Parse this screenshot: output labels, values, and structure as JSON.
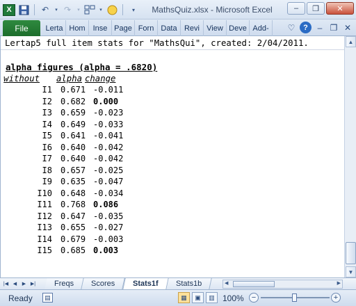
{
  "window": {
    "title": "MathsQuiz.xlsx  -  Microsoft Excel",
    "app_icon": "X",
    "qat_icons": [
      "excel-icon",
      "save-icon",
      "undo-icon",
      "redo-icon",
      "form-icon",
      "smiley-icon",
      "customize-icon"
    ],
    "controls": {
      "minimize": "–",
      "restore": "❐",
      "close": "✕"
    }
  },
  "ribbon": {
    "file_label": "File",
    "tabs": [
      "Lerta",
      "Hom",
      "Inse",
      "Page",
      "Forn",
      "Data",
      "Revi",
      "View",
      "Deve",
      "Add-"
    ],
    "icons": [
      "minimize-ribbon-icon",
      "help-icon",
      "window-minimize-icon",
      "window-restore-icon",
      "window-close-icon"
    ]
  },
  "sheet": {
    "title_line": "Lertap5 full item stats for \"MathsQui\", created: 2/04/2011.",
    "alpha_heading": "alpha figures (alpha =  .6820)",
    "columns": {
      "without": "without",
      "alpha": "alpha",
      "change": "change"
    },
    "rows": [
      {
        "item": "I1",
        "alpha": "0.671",
        "change": "-0.011",
        "bold": false
      },
      {
        "item": "I2",
        "alpha": "0.682",
        "change": "0.000",
        "bold": true
      },
      {
        "item": "I3",
        "alpha": "0.659",
        "change": "-0.023",
        "bold": false
      },
      {
        "item": "I4",
        "alpha": "0.649",
        "change": "-0.033",
        "bold": false
      },
      {
        "item": "I5",
        "alpha": "0.641",
        "change": "-0.041",
        "bold": false
      },
      {
        "item": "I6",
        "alpha": "0.640",
        "change": "-0.042",
        "bold": false
      },
      {
        "item": "I7",
        "alpha": "0.640",
        "change": "-0.042",
        "bold": false
      },
      {
        "item": "I8",
        "alpha": "0.657",
        "change": "-0.025",
        "bold": false
      },
      {
        "item": "I9",
        "alpha": "0.635",
        "change": "-0.047",
        "bold": false
      },
      {
        "item": "I10",
        "alpha": "0.648",
        "change": "-0.034",
        "bold": false
      },
      {
        "item": "I11",
        "alpha": "0.768",
        "change": "0.086",
        "bold": true
      },
      {
        "item": "I12",
        "alpha": "0.647",
        "change": "-0.035",
        "bold": false
      },
      {
        "item": "I13",
        "alpha": "0.655",
        "change": "-0.027",
        "bold": false
      },
      {
        "item": "I14",
        "alpha": "0.679",
        "change": "-0.003",
        "bold": false
      },
      {
        "item": "I15",
        "alpha": "0.685",
        "change": "0.003",
        "bold": true
      }
    ]
  },
  "sheet_tabs": {
    "tabs": [
      "Freqs",
      "Scores",
      "Stats1f",
      "Stats1b"
    ],
    "active": "Stats1f"
  },
  "status": {
    "ready": "Ready",
    "zoom": "100%",
    "zoom_minus": "−",
    "zoom_plus": "+"
  }
}
